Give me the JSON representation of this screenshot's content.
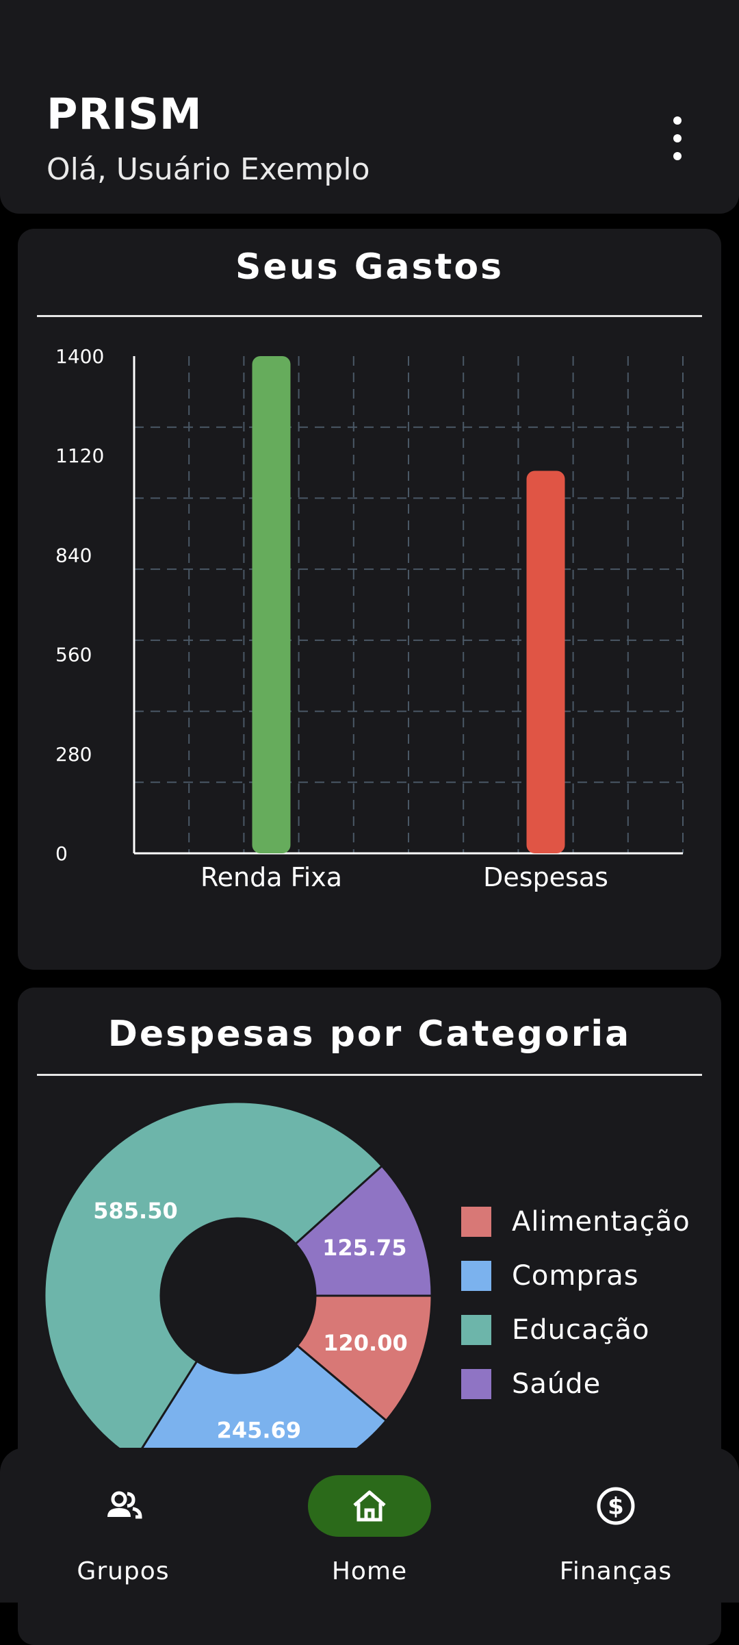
{
  "header": {
    "title": "PRISM",
    "greeting": "Olá, Usuário Exemplo",
    "menu_icon": "more-vert-icon"
  },
  "spending_card": {
    "title": "Seus Gastos"
  },
  "category_card": {
    "title": "Despesas por Categoria"
  },
  "chart_data": [
    {
      "type": "bar",
      "title": "Seus Gastos",
      "categories": [
        "Renda Fixa",
        "Despesas"
      ],
      "values": [
        1400,
        1077
      ],
      "colors": [
        "#66ac5c",
        "#e05545"
      ],
      "ylim": [
        0,
        1400
      ],
      "yticks": [
        0,
        280,
        560,
        840,
        1120,
        1400
      ],
      "ytick_labels": [
        "0",
        "280",
        "560",
        "840",
        "1120",
        "1400"
      ],
      "grid": true
    },
    {
      "type": "pie",
      "title": "Despesas por Categoria",
      "style": "donut",
      "slices": [
        {
          "label": "Alimentação",
          "value": 120.0,
          "value_label": "120.00",
          "color": "#d87876"
        },
        {
          "label": "Compras",
          "value": 245.69,
          "value_label": "245.69",
          "color": "#7bb2ee"
        },
        {
          "label": "Educação",
          "value": 585.5,
          "value_label": "585.50",
          "color": "#6db5aa"
        },
        {
          "label": "Saúde",
          "value": 125.75,
          "value_label": "125.75",
          "color": "#8f74c4"
        }
      ],
      "legend_position": "right"
    }
  ],
  "bottom_nav": {
    "items": [
      {
        "label": "Grupos",
        "icon": "group-icon",
        "active": false
      },
      {
        "label": "Home",
        "icon": "home-icon",
        "active": true
      },
      {
        "label": "Finanças",
        "icon": "dollar-circle-icon",
        "active": false
      }
    ],
    "active_color": "#2b6a1a"
  }
}
